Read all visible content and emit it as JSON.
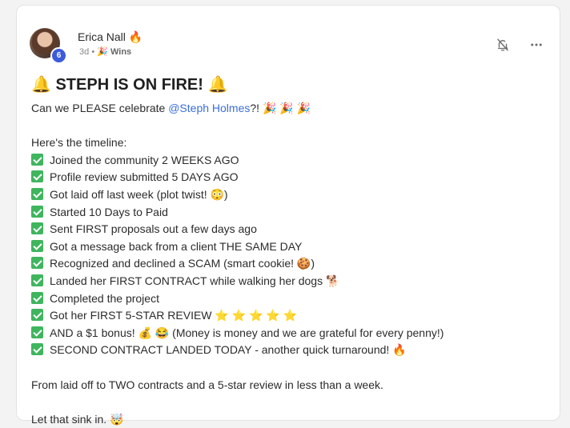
{
  "post": {
    "author": {
      "name": "Erica Nall",
      "name_emoji": "🔥",
      "level": "6"
    },
    "meta": {
      "time": "3d",
      "separator": "•",
      "category_emoji": "🎉",
      "category": "Wins"
    },
    "actions": {
      "bell_icon": "bell-off-icon",
      "more_icon": "more-horizontal-icon"
    },
    "title": "🔔 STEPH IS ON FIRE! 🔔",
    "intro": {
      "before": "Can we PLEASE celebrate ",
      "mention": "@Steph Holmes",
      "after": "?! 🎉 🎉 🎉"
    },
    "timeline_heading": "Here's the timeline:",
    "timeline": [
      "Joined the community 2 WEEKS AGO",
      "Profile review submitted 5 DAYS AGO",
      "Got laid off last week (plot twist! 😳)",
      "Started 10 Days to Paid",
      "Sent FIRST proposals out a few days ago",
      "Got a message back from a client THE SAME DAY",
      "Recognized and declined a SCAM (smart cookie! 🍪)",
      "Landed her FIRST CONTRACT while walking her dogs 🐕",
      "Completed the project",
      "Got her FIRST 5-STAR REVIEW ⭐ ⭐ ⭐ ⭐ ⭐",
      "AND a $1 bonus! 💰 😂 (Money is money and we are grateful for every penny!)",
      "SECOND CONTRACT LANDED TODAY - another quick turnaround! 🔥"
    ],
    "summary": "From laid off to TWO contracts and a 5-star review in less than a week.",
    "closing": "Let that sink in. 🤯"
  },
  "colors": {
    "mention": "#3b6fd8",
    "check": "#3fb55e",
    "level_badge": "#3b5bdb"
  }
}
